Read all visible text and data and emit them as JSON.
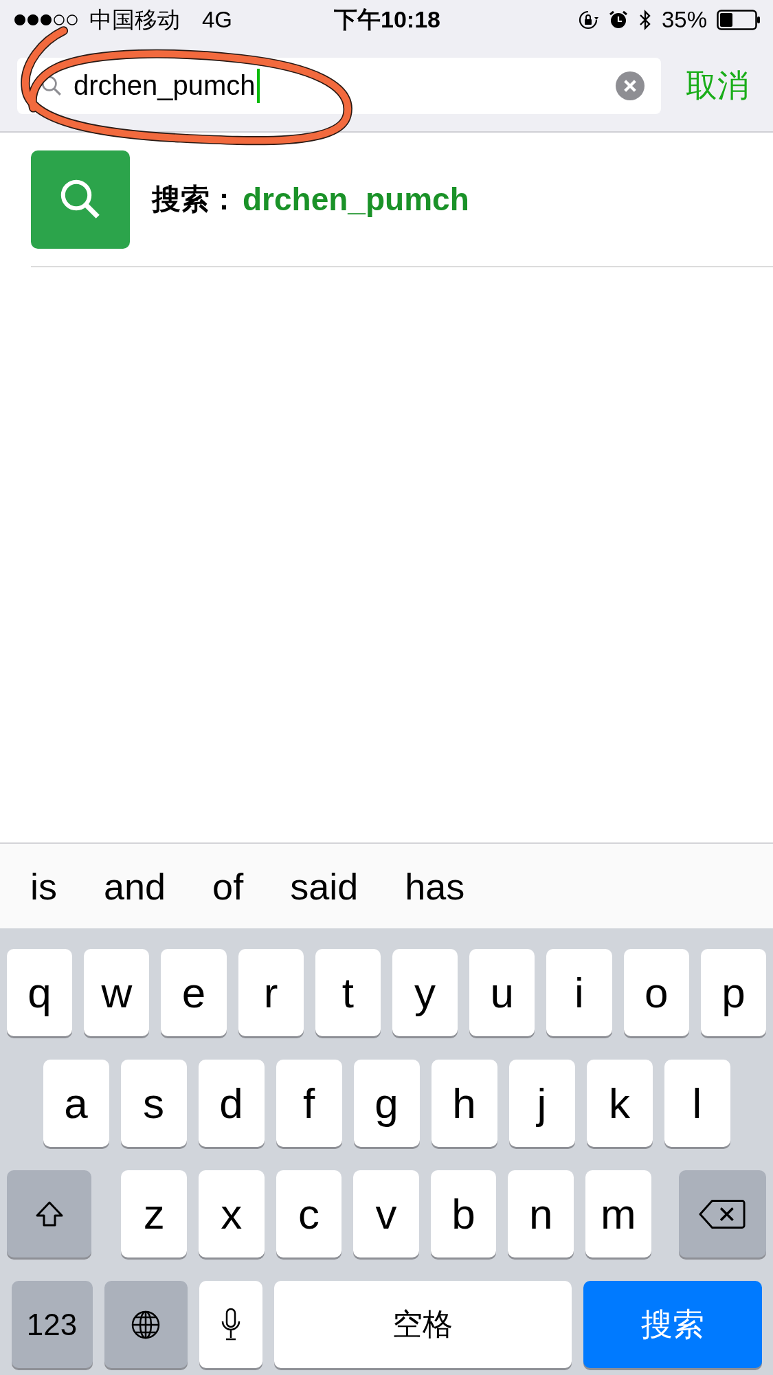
{
  "status_bar": {
    "carrier": "中国移动",
    "network": "4G",
    "time": "下午10:18",
    "battery": "35%"
  },
  "search": {
    "value": "drchen_pumch",
    "cancel": "取消"
  },
  "results": [
    {
      "label": "搜索：",
      "query": "drchen_pumch"
    }
  ],
  "suggestions": [
    "is",
    "and",
    "of",
    "said",
    "has"
  ],
  "keyboard": {
    "rows": [
      {
        "keys": [
          {
            "kind": "letter",
            "label": "q"
          },
          {
            "kind": "letter",
            "label": "w"
          },
          {
            "kind": "letter",
            "label": "e"
          },
          {
            "kind": "letter",
            "label": "r"
          },
          {
            "kind": "letter",
            "label": "t"
          },
          {
            "kind": "letter",
            "label": "y"
          },
          {
            "kind": "letter",
            "label": "u"
          },
          {
            "kind": "letter",
            "label": "i"
          },
          {
            "kind": "letter",
            "label": "o"
          },
          {
            "kind": "letter",
            "label": "p"
          }
        ]
      },
      {
        "keys": [
          {
            "kind": "letter",
            "label": "a"
          },
          {
            "kind": "letter",
            "label": "s"
          },
          {
            "kind": "letter",
            "label": "d"
          },
          {
            "kind": "letter",
            "label": "f"
          },
          {
            "kind": "letter",
            "label": "g"
          },
          {
            "kind": "letter",
            "label": "h"
          },
          {
            "kind": "letter",
            "label": "j"
          },
          {
            "kind": "letter",
            "label": "k"
          },
          {
            "kind": "letter",
            "label": "l"
          }
        ]
      },
      {
        "keys": [
          {
            "kind": "shift"
          },
          {
            "kind": "letter",
            "label": "z"
          },
          {
            "kind": "letter",
            "label": "x"
          },
          {
            "kind": "letter",
            "label": "c"
          },
          {
            "kind": "letter",
            "label": "v"
          },
          {
            "kind": "letter",
            "label": "b"
          },
          {
            "kind": "letter",
            "label": "n"
          },
          {
            "kind": "letter",
            "label": "m"
          },
          {
            "kind": "backspace"
          }
        ]
      },
      {
        "keys": [
          {
            "kind": "numbers",
            "label": "123"
          },
          {
            "kind": "globe"
          },
          {
            "kind": "mic"
          },
          {
            "kind": "space",
            "label": "空格"
          },
          {
            "kind": "action",
            "label": "搜索"
          }
        ]
      }
    ]
  }
}
